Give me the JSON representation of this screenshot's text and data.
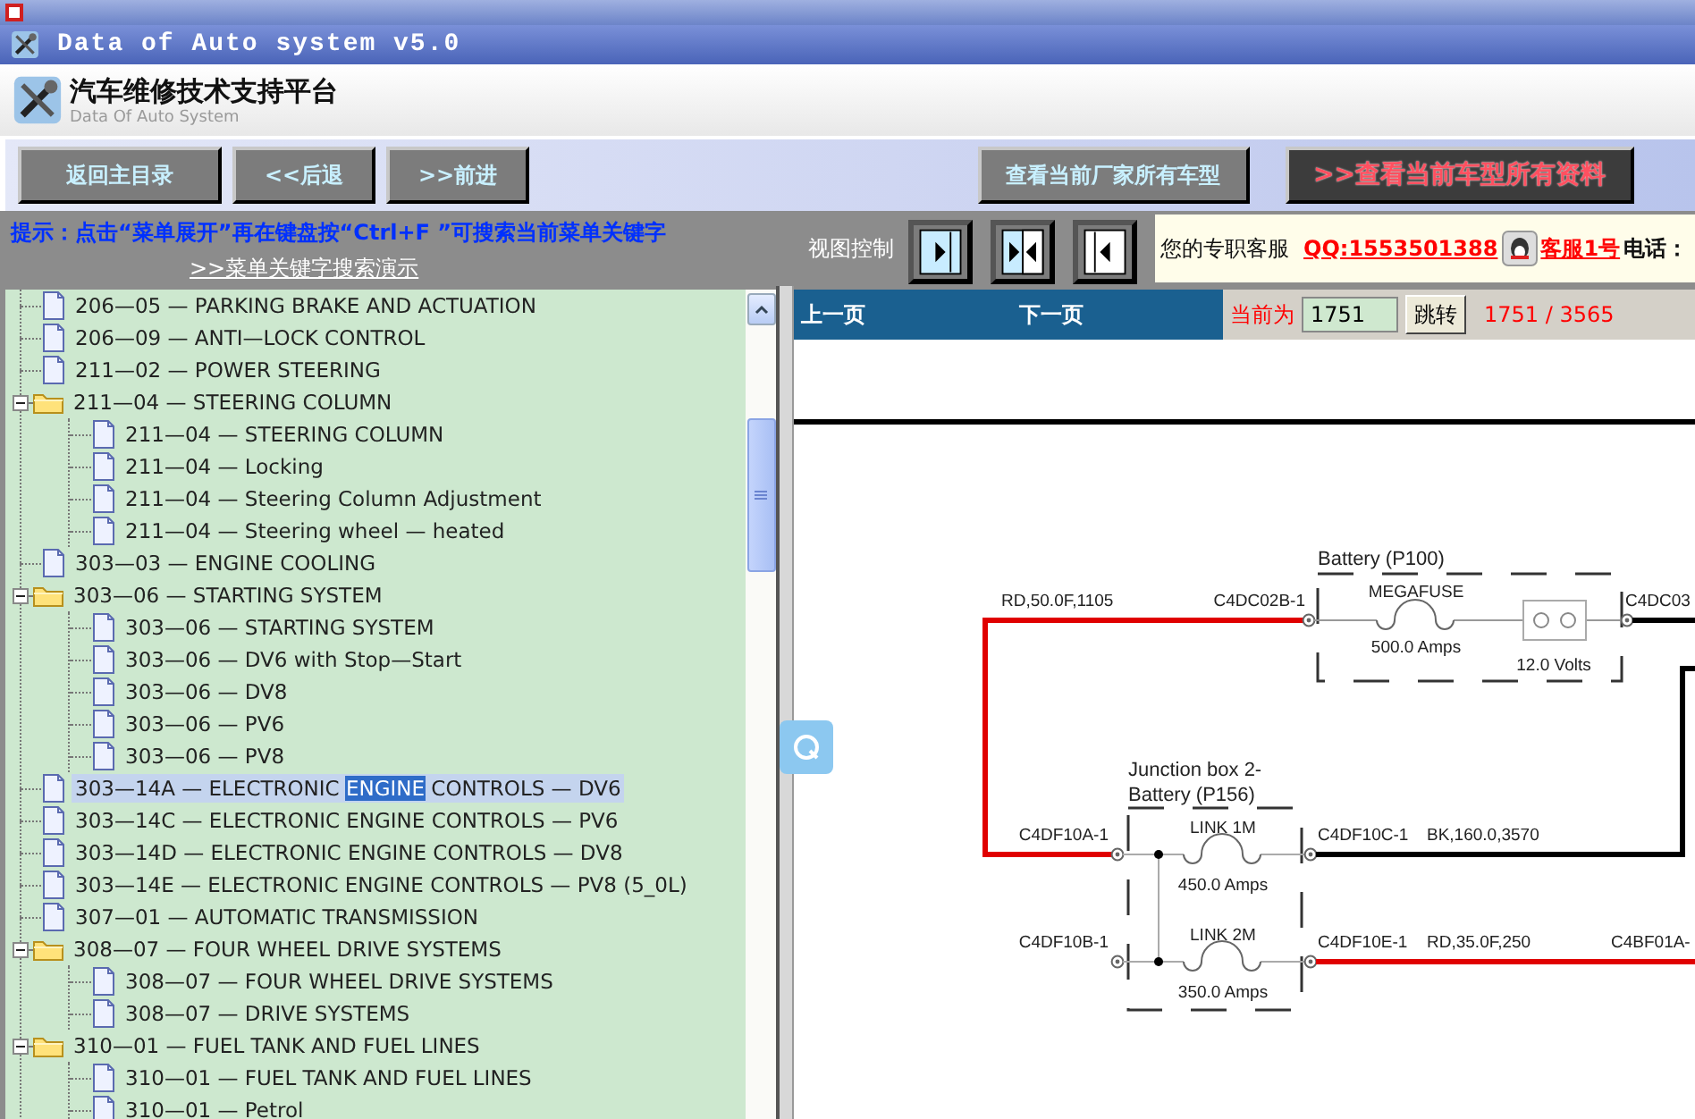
{
  "window": {
    "title": "Data of Auto system v5.0"
  },
  "header": {
    "title": "汽车维修技术支持平台",
    "subtitle": "Data Of Auto System"
  },
  "toolbar": {
    "left_buttons": [
      {
        "label": "返回主目录"
      },
      {
        "label": "<<后退"
      },
      {
        "label": ">>前进"
      }
    ],
    "right_buttons": [
      {
        "label": "查看当前厂家所有车型",
        "kind": "plain"
      },
      {
        "label": ">>查看当前车型所有资料",
        "kind": "highlight"
      }
    ]
  },
  "tip": {
    "text": "提示：点击“菜单展开”再在键盘按“Ctrl+F ”可搜索当前菜单关键字",
    "link": ">>菜单关键字搜索演示"
  },
  "view_control": {
    "label": "视图控制",
    "buttons": [
      {
        "kind": "tree-only"
      },
      {
        "kind": "split"
      },
      {
        "kind": "doc-only"
      }
    ]
  },
  "support": {
    "label": "您的专职客服",
    "qq": "QQ:1553501388",
    "agent": "客服1号",
    "phone_label": "电话："
  },
  "tree": {
    "items": [
      {
        "label": "206—05 — PARKING BRAKE AND ACTUATION",
        "selected": false
      },
      {
        "label": "206—09 — ANTI—LOCK CONTROL",
        "selected": false
      },
      {
        "label": "211—02 — POWER STEERING",
        "selected": false
      },
      {
        "label": "211—04 — STEERING COLUMN",
        "selected": false,
        "expanded": true,
        "children": [
          {
            "label": "211—04 — STEERING COLUMN",
            "selected": false
          },
          {
            "label": "211—04 — Locking",
            "selected": false
          },
          {
            "label": "211—04 — Steering Column Adjustment",
            "selected": false
          },
          {
            "label": "211—04 — Steering wheel — heated",
            "selected": false
          }
        ]
      },
      {
        "label": "303—03 — ENGINE COOLING",
        "selected": false
      },
      {
        "label": "303—06 — STARTING SYSTEM",
        "selected": false,
        "expanded": true,
        "children": [
          {
            "label": "303—06 — STARTING SYSTEM",
            "selected": false
          },
          {
            "label": "303—06 — DV6 with Stop—Start",
            "selected": false
          },
          {
            "label": "303—06 — DV8",
            "selected": false
          },
          {
            "label": "303—06 — PV6",
            "selected": false
          },
          {
            "label": "303—06 — PV8",
            "selected": false
          }
        ]
      },
      {
        "label": "303—14A — ELECTRONIC ",
        "match": "ENGINE",
        "label_rest": " CONTROLS — DV6",
        "selected": true
      },
      {
        "label": "303—14C — ELECTRONIC ENGINE CONTROLS — PV6",
        "selected": false
      },
      {
        "label": "303—14D — ELECTRONIC ENGINE CONTROLS — DV8",
        "selected": false
      },
      {
        "label": "303—14E — ELECTRONIC ENGINE CONTROLS — PV8 (5_0L)",
        "selected": false
      },
      {
        "label": "307—01 — AUTOMATIC TRANSMISSION",
        "selected": false
      },
      {
        "label": "308—07 — FOUR WHEEL DRIVE SYSTEMS",
        "selected": false,
        "expanded": true,
        "children": [
          {
            "label": "308—07 — FOUR WHEEL DRIVE SYSTEMS",
            "selected": false
          },
          {
            "label": "308—07 — DRIVE SYSTEMS",
            "selected": false
          }
        ]
      },
      {
        "label": "310—01 — FUEL TANK AND FUEL LINES",
        "selected": false,
        "expanded": true,
        "children": [
          {
            "label": "310—01 — FUEL TANK AND FUEL LINES",
            "selected": false
          },
          {
            "label": "310—01 — Petrol",
            "selected": false
          }
        ]
      }
    ]
  },
  "pager": {
    "prev": "上一页",
    "next": "下一页",
    "current_label": "当前为",
    "page": "1751",
    "go": "跳转",
    "count": "1751 / 3565"
  },
  "diagram": {
    "battery": {
      "title": "Battery (P100)",
      "wire": "RD,50.0F,1105",
      "in_pin": "C4DC02B-1",
      "fuse": "MEGAFUSE",
      "fuse_rating": "500.0 Amps",
      "voltage": "12.0 Volts",
      "out_pin": "C4DC03"
    },
    "junction": {
      "title_lines": [
        "Junction box 2-",
        "Battery (P156)"
      ],
      "links": [
        {
          "name": "LINK 1M",
          "rating": "450.0 Amps",
          "in_pin": "C4DF10A-1",
          "out_pin": "C4DF10C-1",
          "wire": "BK,160.0,3570",
          "color": "#000000"
        },
        {
          "name": "LINK 2M",
          "rating": "350.0 Amps",
          "in_pin": "C4DF10B-1",
          "out_pin": "C4DF10E-1",
          "wire": "RD,35.0F,250",
          "far_pin": "C4BF01A-",
          "color": "#e00000"
        }
      ]
    }
  }
}
